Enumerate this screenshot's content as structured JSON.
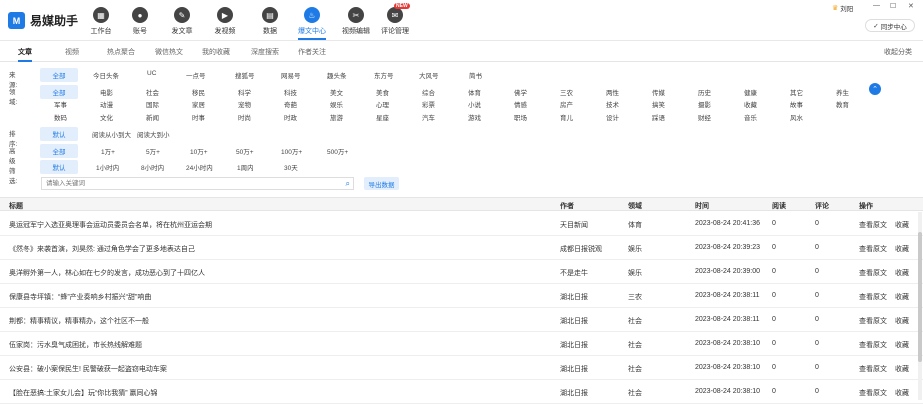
{
  "app": {
    "name": "易媒助手"
  },
  "nav": [
    {
      "label": "工作台",
      "icon": "dashboard-icon",
      "glyph": "▦"
    },
    {
      "label": "账号",
      "icon": "account-icon",
      "glyph": "●"
    },
    {
      "label": "发文章",
      "icon": "post-article-icon",
      "glyph": "✎"
    },
    {
      "label": "发视频",
      "icon": "post-video-icon",
      "glyph": "▶"
    },
    {
      "label": "数据",
      "icon": "data-icon",
      "glyph": "▤"
    },
    {
      "label": "爆文中心",
      "icon": "hot-article-icon",
      "glyph": "♨"
    },
    {
      "label": "视频编辑",
      "icon": "video-edit-icon",
      "glyph": "✂"
    },
    {
      "label": "评论管理",
      "icon": "comment-icon",
      "glyph": "✉",
      "badge": "NEW"
    }
  ],
  "user": {
    "name": "刘阳",
    "min": "—",
    "max": "☐",
    "close": "✕"
  },
  "sync_label": "同步中心",
  "tabs": [
    "文章",
    "视频",
    "热点聚合",
    "微信热文",
    "我的收藏",
    "深度搜索",
    "作者关注"
  ],
  "tabs_right": "收起分类",
  "filters": {
    "source_label": "来源:",
    "sources": [
      "全部",
      "今日头条",
      "UC",
      "一点号",
      "搜狐号",
      "网易号",
      "趣头条",
      "东方号",
      "大风号",
      "简书"
    ],
    "field_label": "领域:",
    "fields_row1": [
      "全部",
      "电影",
      "社会",
      "移民",
      "科学",
      "科技",
      "美文",
      "美食",
      "综合",
      "体育",
      "佛学",
      "三农",
      "两性",
      "传媒",
      "历史",
      "健康",
      "其它",
      "养生"
    ],
    "fields_row2": [
      "军事",
      "动漫",
      "国际",
      "家居",
      "宠物",
      "奇葩",
      "娱乐",
      "心理",
      "彩票",
      "小说",
      "情感",
      "房产",
      "技术",
      "搞笑",
      "摄影",
      "收藏",
      "故事",
      "教育"
    ],
    "fields_row3": [
      "数码",
      "文化",
      "新闻",
      "时事",
      "时尚",
      "时政",
      "旅游",
      "星座",
      "汽车",
      "游戏",
      "职场",
      "育儿",
      "设计",
      "踩语",
      "财经",
      "音乐",
      "风水"
    ],
    "sort_label": "排序:",
    "sorts": [
      "默认",
      "阅读从小到大",
      "阅读大到小"
    ],
    "advanced_label": "高级筛选:",
    "reads": [
      "全部",
      "1万+",
      "5万+",
      "10万+",
      "50万+",
      "100万+",
      "500万+"
    ],
    "times": [
      "默认",
      "1小时内",
      "8小时内",
      "24小时内",
      "1周内",
      "30天"
    ]
  },
  "search": {
    "placeholder": "请输入关键词",
    "export_label": "导出数据"
  },
  "table": {
    "headers": {
      "title": "标题",
      "author": "作者",
      "field": "领域",
      "time": "时间",
      "reads": "阅读",
      "comments": "评论",
      "actions": "操作"
    },
    "view_label": "查看原文",
    "fav_label": "收藏",
    "rows": [
      {
        "title": "奥运冠军宁入选亚奥理事会运动员委员会名单，将在杭州亚运会期",
        "author": "天目新闻",
        "field": "体育",
        "time": "2023-08-24 20:41:36",
        "reads": "0",
        "comments": "0"
      },
      {
        "title": "《然冬》来袭首演，刘昊然: 通过角色学会了更多地表达自己",
        "author": "成都日报锐观",
        "field": "娱乐",
        "time": "2023-08-24 20:39:23",
        "reads": "0",
        "comments": "0"
      },
      {
        "title": "奥洋孵外第一人，林心如在七夕的发言，成功恶心到了十四亿人",
        "author": "不是走牛",
        "field": "娱乐",
        "time": "2023-08-24 20:39:00",
        "reads": "0",
        "comments": "0"
      },
      {
        "title": "保康县寺坪镇：“蜂”产业奏响乡村振兴“甜”响曲",
        "author": "湖北日报",
        "field": "三农",
        "time": "2023-08-24 20:38:11",
        "reads": "0",
        "comments": "0"
      },
      {
        "title": "荆都：精事精议，精事精办，这个社区不一般",
        "author": "湖北日报",
        "field": "社会",
        "time": "2023-08-24 20:38:11",
        "reads": "0",
        "comments": "0"
      },
      {
        "title": "伍家岗：污水臭气成困扰，市长热线解难题",
        "author": "湖北日报",
        "field": "社会",
        "time": "2023-08-24 20:38:10",
        "reads": "0",
        "comments": "0"
      },
      {
        "title": "公安县：破小案保民生! 民警破获一起盗窃电动车案",
        "author": "湖北日报",
        "field": "社会",
        "time": "2023-08-24 20:38:10",
        "reads": "0",
        "comments": "0"
      },
      {
        "title": "【脸在恶搞:土家女儿会】玩“你比我猜” 赢同心锦",
        "author": "湖北日报",
        "field": "社会",
        "time": "2023-08-24 20:38:10",
        "reads": "0",
        "comments": "0"
      }
    ]
  }
}
